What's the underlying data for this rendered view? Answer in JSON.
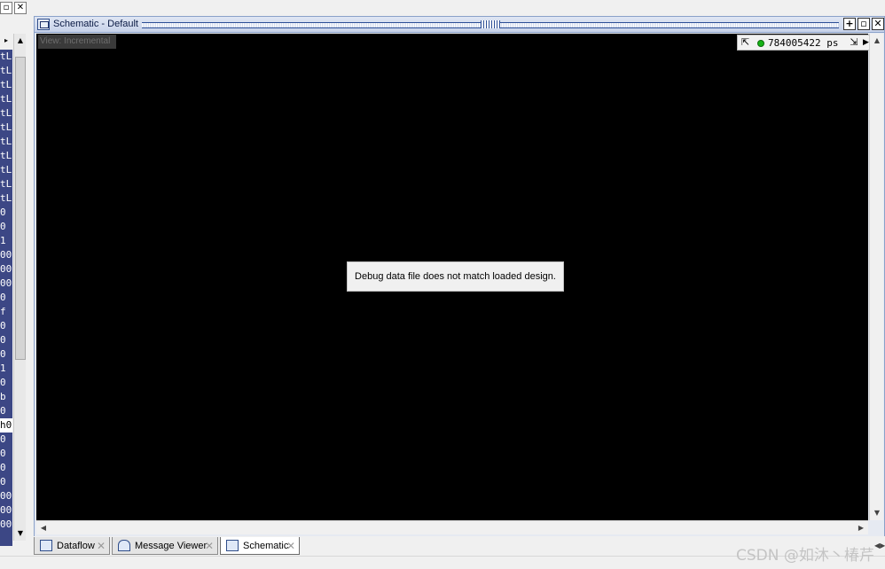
{
  "left_pane": {
    "float_label": "▫",
    "close_label": "✕",
    "expand_label": "▸",
    "scroll_up": "▲",
    "scroll_down": "▼",
    "values": [
      "tL",
      "tL",
      "tL",
      "tL",
      "tL",
      "tL",
      "tL",
      "tL",
      "tL",
      "tL",
      "tL",
      "0",
      "0",
      "1",
      "00",
      "00",
      "00",
      "0",
      "f",
      "0",
      "0",
      "0",
      "1",
      "0",
      "b",
      "0",
      "h0",
      "0",
      "0",
      "0",
      "0",
      "00",
      "00",
      "00"
    ],
    "selected_index": 26
  },
  "schematic": {
    "title": "Schematic - Default",
    "view_label": "View: Incremental",
    "time": "784005422 ps",
    "message": "Debug data file does not match loaded design.",
    "buttons": {
      "add": "+",
      "float": "▫",
      "close": "✕"
    },
    "scroll_up": "▲",
    "scroll_down": "▼",
    "scroll_left": "◀",
    "scroll_right": "▶",
    "status_color": "#17b317"
  },
  "tabs": [
    {
      "label": "Dataflow",
      "close": "✕",
      "active": false,
      "icon": "dataflow-icon"
    },
    {
      "label": "Message Viewer",
      "close": "✕",
      "active": false,
      "icon": "message-viewer-icon"
    },
    {
      "label": "Schematic",
      "close": "✕",
      "active": true,
      "icon": "schematic-icon"
    }
  ],
  "watermark": "CSDN @如沐丶椿芹"
}
